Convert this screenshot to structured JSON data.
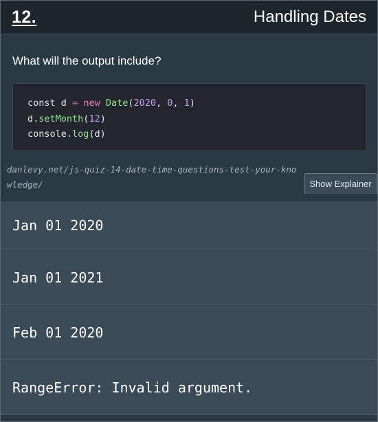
{
  "header": {
    "question_number": "12.",
    "title": "Handling Dates"
  },
  "question": {
    "text": "What will the output include?"
  },
  "code": {
    "lines": [
      [
        {
          "t": "const ",
          "k": "plain"
        },
        {
          "t": "d",
          "k": "plain"
        },
        {
          "t": " = ",
          "k": "keyword"
        },
        {
          "t": "new ",
          "k": "keyword"
        },
        {
          "t": "Date",
          "k": "func"
        },
        {
          "t": "(",
          "k": "plain"
        },
        {
          "t": "2020",
          "k": "number"
        },
        {
          "t": ", ",
          "k": "plain"
        },
        {
          "t": "0",
          "k": "number"
        },
        {
          "t": ", ",
          "k": "plain"
        },
        {
          "t": "1",
          "k": "number"
        },
        {
          "t": ")",
          "k": "plain"
        }
      ],
      [
        {
          "t": "d.",
          "k": "plain"
        },
        {
          "t": "setMonth",
          "k": "func"
        },
        {
          "t": "(",
          "k": "plain"
        },
        {
          "t": "12",
          "k": "number"
        },
        {
          "t": ")",
          "k": "plain"
        }
      ],
      [
        {
          "t": "console.",
          "k": "plain"
        },
        {
          "t": "log",
          "k": "func"
        },
        {
          "t": "(d)",
          "k": "plain"
        }
      ]
    ]
  },
  "source": {
    "link_text": "danlevy.net/js-quiz-14-date-time-questions-test-your-knowledge/"
  },
  "explainer": {
    "button_label": "Show Explainer"
  },
  "options": [
    {
      "label": "Jan 01 2020"
    },
    {
      "label": "Jan 01 2021"
    },
    {
      "label": "Feb 01 2020"
    },
    {
      "label": "RangeError: Invalid argument."
    }
  ],
  "colors": {
    "header_bg": "#1d262d",
    "card_bg": "#2a3a44",
    "option_bg": "#3a4b57",
    "code_bg": "#23262f",
    "keyword": "#f07ab8",
    "function": "#8fe388",
    "number": "#c99cf5"
  }
}
